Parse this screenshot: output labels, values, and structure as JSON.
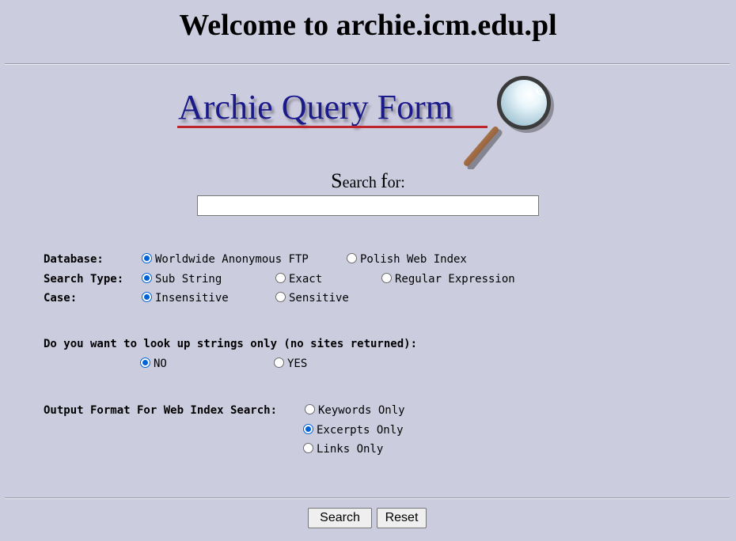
{
  "page": {
    "title": "Welcome to archie.icm.edu.pl"
  },
  "logo": {
    "text": "Archie Query Form"
  },
  "search": {
    "label_first": "S",
    "label_rest": "earch ",
    "label_f": "f",
    "label_end": "or:",
    "value": ""
  },
  "database": {
    "label": "Database:",
    "options": [
      {
        "label": "Worldwide Anonymous FTP",
        "checked": true
      },
      {
        "label": "Polish Web Index",
        "checked": false
      }
    ]
  },
  "search_type": {
    "label": "Search Type:",
    "options": [
      {
        "label": "Sub String",
        "checked": true
      },
      {
        "label": "Exact",
        "checked": false
      },
      {
        "label": "Regular Expression",
        "checked": false
      }
    ]
  },
  "case": {
    "label": "Case:",
    "options": [
      {
        "label": "Insensitive",
        "checked": true
      },
      {
        "label": "Sensitive",
        "checked": false
      }
    ]
  },
  "strings_only": {
    "label": "Do you want to look up strings only (no sites returned):",
    "options": [
      {
        "label": "NO",
        "checked": true
      },
      {
        "label": "YES",
        "checked": false
      }
    ]
  },
  "output_format": {
    "label": "Output Format For Web Index Search:",
    "options": [
      {
        "label": "Keywords Only",
        "checked": false
      },
      {
        "label": "Excerpts Only",
        "checked": true
      },
      {
        "label": "Links Only",
        "checked": false
      }
    ]
  },
  "buttons": {
    "search": "Search",
    "reset": "Reset"
  }
}
